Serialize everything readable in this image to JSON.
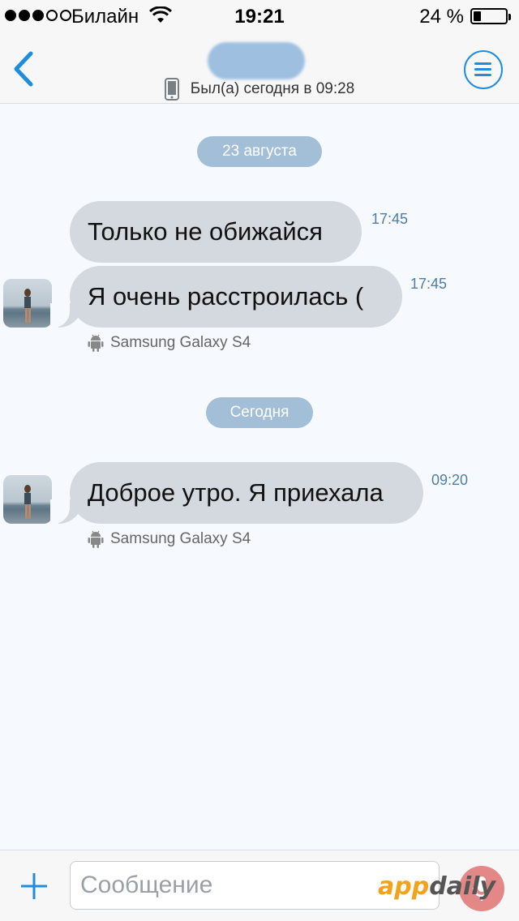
{
  "status_bar": {
    "signal_dots_filled": 3,
    "signal_dots_total": 5,
    "carrier": "Билайн",
    "time": "19:21",
    "battery_percent": "24 %",
    "battery_level": 0.24
  },
  "header": {
    "back_icon": "chevron-left-icon",
    "contact_name_redacted": true,
    "presence_icon": "phone-icon",
    "presence": "Был(а) сегодня в 09:28",
    "menu_icon": "menu-icon"
  },
  "chat": {
    "date_1": "23 августа",
    "messages_day1": [
      {
        "text": "Только не обижайся",
        "time": "17:45"
      },
      {
        "text": "Я очень расстроилась (",
        "time": "17:45"
      }
    ],
    "device_1": "Samsung Galaxy S4",
    "date_2": "Сегодня",
    "messages_day2": [
      {
        "text": "Доброе утро. Я приехала",
        "time": "09:20"
      }
    ],
    "device_2": "Samsung Galaxy S4"
  },
  "composer": {
    "placeholder": "Сообщение",
    "value": "",
    "add_icon": "plus-icon",
    "mic_icon": "microphone-icon"
  },
  "watermark": {
    "part1": "app",
    "part2": "daily"
  },
  "colors": {
    "accent": "#1f8ddc",
    "bubble": "#d4d9df",
    "date_chip": "#a3bfd7",
    "time_text": "#4f7ea3",
    "background": "#f6faff"
  }
}
